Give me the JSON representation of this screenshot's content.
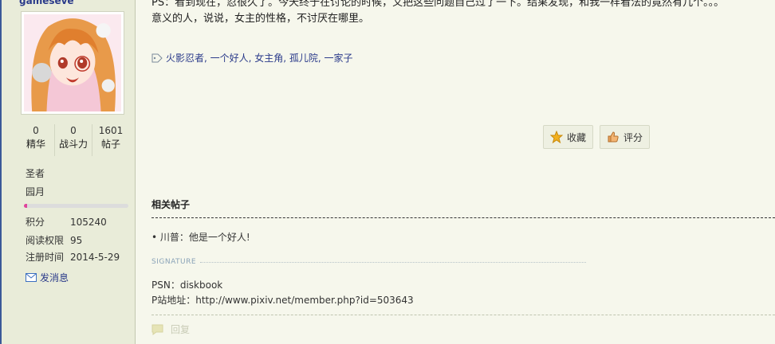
{
  "user": {
    "name": "gameseve",
    "stats": [
      {
        "value": "0",
        "label": "精华"
      },
      {
        "value": "0",
        "label": "战斗力"
      },
      {
        "value": "1601",
        "label": "帖子"
      }
    ],
    "group": "圣者",
    "title": "园月",
    "level_progress": 0.03,
    "info": [
      {
        "key": "积分",
        "value": "105240"
      },
      {
        "key": "阅读权限",
        "value": "95"
      },
      {
        "key": "注册时间",
        "value": "2014-5-29"
      }
    ],
    "pm_label": "发消息"
  },
  "post": {
    "line1": "PS：看到现在，忍很久了。今天终于在讨论的时候，又把这些问题自己过了一下。结果发现，和我一样看法的竟然有几个。。。",
    "line2": "意义的人，说说，女主的性格，不讨厌在哪里。",
    "tags": "火影忍者, 一个好人, 女主角, 孤儿院, 一家子"
  },
  "actions": {
    "favorite": "收藏",
    "rate": "评分"
  },
  "related": {
    "title": "相关帖子",
    "item": "• 川普：他是一个好人!"
  },
  "signature": {
    "label": "SIGNATURE",
    "psn": "PSN：diskbook",
    "pixiv": "P站地址：http://www.pixiv.net/member.php?id=503643"
  },
  "reply_label": "回复",
  "colors": {
    "accent": "#2a3a8a",
    "level_bar": "#e0449b",
    "background": "#f6f7ec",
    "sidebar": "#e9ecd9"
  }
}
